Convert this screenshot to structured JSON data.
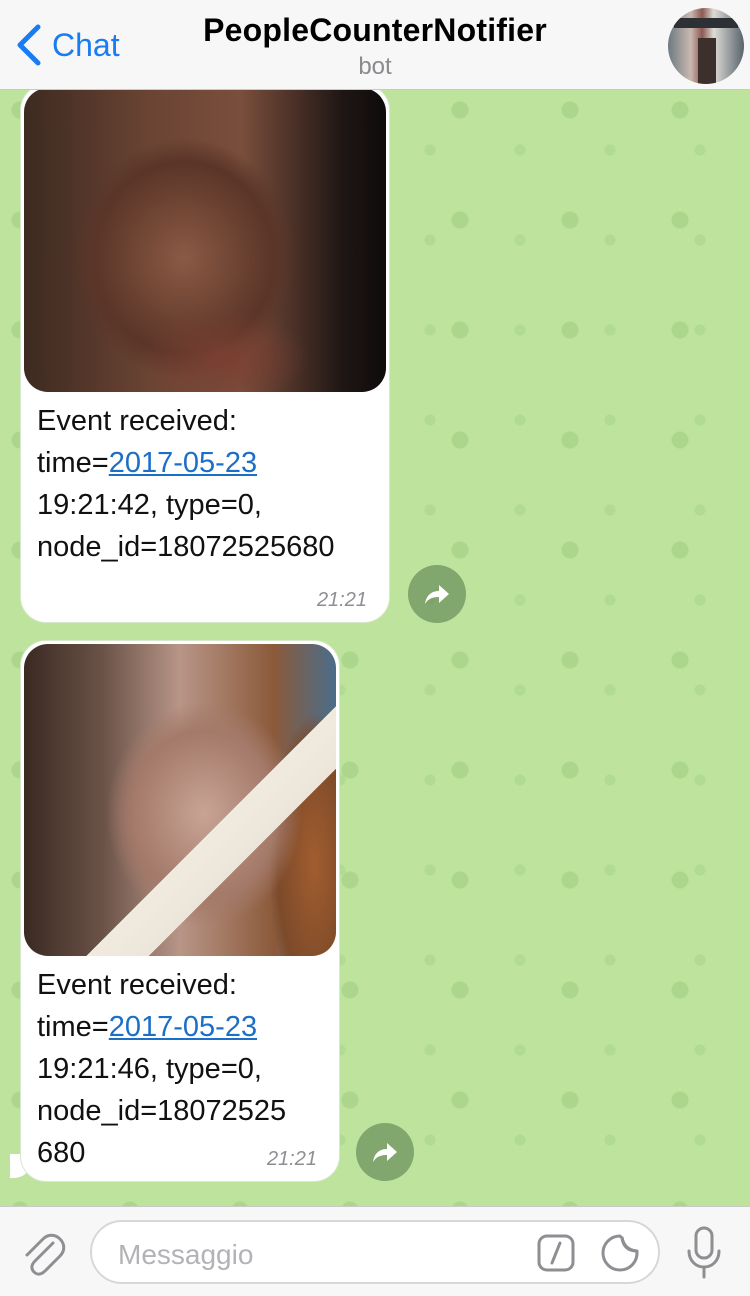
{
  "header": {
    "back_label": "Chat",
    "title": "PeopleCounterNotifier",
    "subtitle": "bot"
  },
  "messages": [
    {
      "line1": "Event received:",
      "time_prefix": "time=",
      "date_link": "2017-05-23",
      "line3": "19:21:42, type=0,",
      "line4": "node_id=18072525680",
      "line5": "",
      "timestamp": "21:21"
    },
    {
      "line1": "Event received:",
      "time_prefix": "time=",
      "date_link": "2017-05-23",
      "line3": "19:21:46, type=0,",
      "line4": "node_id=18072525",
      "line5": "680",
      "timestamp": "21:21"
    }
  ],
  "input": {
    "placeholder": "Messaggio"
  },
  "icons": {
    "back": "chevron-left-icon",
    "share": "share-icon",
    "attach": "paperclip-icon",
    "commands": "slash-command-icon",
    "stickers": "sticker-icon",
    "mic": "microphone-icon"
  },
  "colors": {
    "accent": "#1a7cf2",
    "link": "#1b6fc7",
    "chat_background": "#bde39d"
  }
}
